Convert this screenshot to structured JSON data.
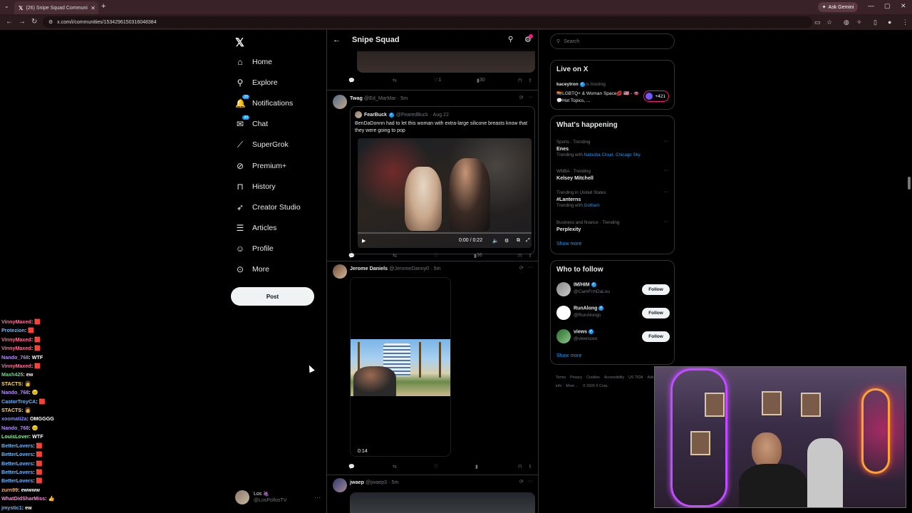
{
  "browser": {
    "tab_title": "(26) Snipe Squad Communi",
    "url": "x.com/i/communities/1534296150316048384",
    "gemini_label": "Ask Gemini"
  },
  "nav": {
    "items": [
      {
        "label": "Home",
        "icon": "home-icon",
        "glyph": "⌂"
      },
      {
        "label": "Explore",
        "icon": "search-icon",
        "glyph": "⚲"
      },
      {
        "label": "Notifications",
        "icon": "bell-icon",
        "glyph": "🔔",
        "badge": "20"
      },
      {
        "label": "Chat",
        "icon": "chat-icon",
        "glyph": "✉",
        "badge": "20"
      },
      {
        "label": "SuperGrok",
        "icon": "grok-icon",
        "glyph": "⟋"
      },
      {
        "label": "Premium+",
        "icon": "premium-icon",
        "glyph": "⊘"
      },
      {
        "label": "History",
        "icon": "bookmark-icon",
        "glyph": "⊓"
      },
      {
        "label": "Creator Studio",
        "icon": "rocket-icon",
        "glyph": "➶"
      },
      {
        "label": "Articles",
        "icon": "article-icon",
        "glyph": "☰"
      },
      {
        "label": "Profile",
        "icon": "profile-icon",
        "glyph": "☺"
      },
      {
        "label": "More",
        "icon": "more-icon",
        "glyph": "⊙"
      }
    ],
    "post_label": "Post"
  },
  "account": {
    "name": "Los 🍇",
    "handle": "@LosPollosTV"
  },
  "chat": [
    {
      "user": "VinnyMaxed",
      "msg": "🟥",
      "color": "#ff6f9a"
    },
    {
      "user": "Protezion",
      "msg": "🟥",
      "color": "#69b8ff"
    },
    {
      "user": "VinnyMaxed",
      "msg": "🟥",
      "color": "#ff6f9a"
    },
    {
      "user": "VinnyMaxed",
      "msg": "🟥",
      "color": "#ff6f9a"
    },
    {
      "user": "Nando_768",
      "msg": "WTF",
      "color": "#b98cff"
    },
    {
      "user": "VinnyMaxed",
      "msg": "🟥",
      "color": "#ff6f9a"
    },
    {
      "user": "Maxh425",
      "msg": "ew",
      "color": "#6fdc8c"
    },
    {
      "user": "STACTS",
      "msg": "👩",
      "color": "#ffd86a"
    },
    {
      "user": "Nando_768",
      "msg": "😐",
      "color": "#b98cff"
    },
    {
      "user": "CastorTroyCA",
      "msg": "🟥",
      "color": "#69b8ff"
    },
    {
      "user": "STACTS",
      "msg": "👩",
      "color": "#ffd86a"
    },
    {
      "user": "xoomati2a",
      "msg": "OMGGGG",
      "color": "#8a8aff"
    },
    {
      "user": "Nando_768",
      "msg": "😐",
      "color": "#b98cff"
    },
    {
      "user": "LouisLover",
      "msg": "WTF",
      "color": "#7dff9a"
    },
    {
      "user": "BetterLovers",
      "msg": "🟥",
      "color": "#69b8ff"
    },
    {
      "user": "BetterLovers",
      "msg": "🟥",
      "color": "#69b8ff"
    },
    {
      "user": "BetterLovers",
      "msg": "🟥",
      "color": "#69b8ff"
    },
    {
      "user": "BetterLovers",
      "msg": "🟥",
      "color": "#69b8ff"
    },
    {
      "user": "BetterLovers",
      "msg": "🟥",
      "color": "#69b8ff"
    },
    {
      "user": "zurn99",
      "msg": "ewwww",
      "color": "#ffb26a"
    },
    {
      "user": "WhatDidSharMiss",
      "msg": "👍",
      "color": "#ff8ad8"
    },
    {
      "user": "jmystic1",
      "msg": "ew",
      "color": "#69b8ff"
    }
  ],
  "community": {
    "title": "Snipe Squad"
  },
  "top_post": {
    "likes": "1",
    "views": "30"
  },
  "posts": [
    {
      "name": "Twag",
      "handle": "@Ed_MarMar",
      "time": "· 5m",
      "quote_name": "FearBuck",
      "quote_handle": "@FearedBuck",
      "quote_time": "· Aug 22",
      "quote_text": "BenDaDonnn had to let this woman with extra-large silicone breasts know that they were going to pop",
      "video_time": "0:00 / 0:22",
      "views": "36"
    },
    {
      "name": "Jerome Daniels",
      "handle": "@JeromeDanny0",
      "time": "· 5m",
      "duration": "0:14"
    },
    {
      "name": "jwaep",
      "handle": "@jwaep3",
      "time": "· 5m"
    }
  ],
  "right": {
    "search_placeholder": "Search",
    "live_title": "Live on X",
    "live_host": "kaceytron",
    "live_hosting": "is hosting",
    "live_text": "🏳️‍🌈LGBTQ+ & Woman Space💋 🇺🇸 - 👄💬Hot Topics, ...",
    "live_count": "+421",
    "happening_title": "What's happening",
    "trends": [
      {
        "cat": "Sports · Trending",
        "name": "Enes",
        "sub_prefix": "Trending with",
        "sub_links": "Natasha Cloud, Chicago Sky"
      },
      {
        "cat": "WNBA · Trending",
        "name": "Kelsey Mitchell",
        "sub_prefix": "",
        "sub_links": ""
      },
      {
        "cat": "Trending in United States",
        "name": "#Lanterns",
        "sub_prefix": "Trending with",
        "sub_links": "Gotham"
      },
      {
        "cat": "Business and finance · Trending",
        "name": "Perplexity",
        "sub_prefix": "",
        "sub_links": ""
      }
    ],
    "show_more": "Show more",
    "wtf_title": "Who to follow",
    "follow": [
      {
        "name": "IM/HIM",
        "handle": "@CamFrmDaLou",
        "btn": "Follow"
      },
      {
        "name": "RunAlong",
        "handle": "@RunAlongs",
        "btn": "Follow"
      },
      {
        "name": "views",
        "handle": "@viewsceo",
        "btn": "Follow"
      }
    ],
    "footer": [
      "Terms",
      "Privacy",
      "Cookies",
      "Accessibility",
      "US TIDA",
      "Ads info",
      "More ...",
      "© 2026 X Corp."
    ]
  }
}
